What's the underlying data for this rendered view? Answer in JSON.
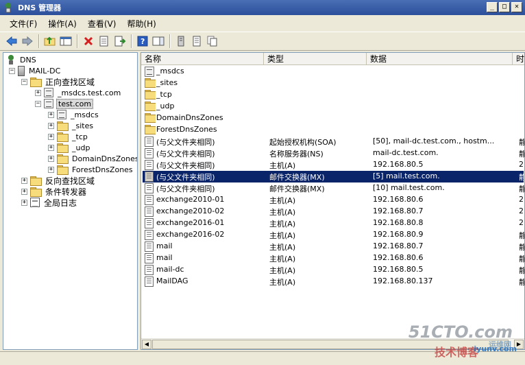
{
  "window": {
    "title": "DNS 管理器",
    "minimize": "_",
    "maximize": "□",
    "close": "✕"
  },
  "menu": [
    "文件(F)",
    "操作(A)",
    "查看(V)",
    "帮助(H)"
  ],
  "tree": [
    {
      "label": "DNS",
      "level": 0,
      "icon": "dns-icon",
      "expander": ""
    },
    {
      "label": "MAIL-DC",
      "level": 1,
      "icon": "server-icon",
      "expander": "−"
    },
    {
      "label": "正向查找区域",
      "level": 2,
      "icon": "folder-icon",
      "expander": "−"
    },
    {
      "label": "_msdcs.test.com",
      "level": 3,
      "icon": "zone-icon",
      "expander": "+"
    },
    {
      "label": "test.com",
      "level": 3,
      "icon": "zone-icon",
      "expander": "−",
      "selected": true
    },
    {
      "label": "_msdcs",
      "level": 4,
      "icon": "zone-icon",
      "expander": "+"
    },
    {
      "label": "_sites",
      "level": 4,
      "icon": "folder-icon",
      "expander": "+"
    },
    {
      "label": "_tcp",
      "level": 4,
      "icon": "folder-icon",
      "expander": "+"
    },
    {
      "label": "_udp",
      "level": 4,
      "icon": "folder-icon",
      "expander": "+"
    },
    {
      "label": "DomainDnsZones",
      "level": 4,
      "icon": "folder-icon",
      "expander": "+"
    },
    {
      "label": "ForestDnsZones",
      "level": 4,
      "icon": "folder-icon",
      "expander": "+"
    },
    {
      "label": "反向查找区域",
      "level": 2,
      "icon": "folder-icon",
      "expander": "+"
    },
    {
      "label": "条件转发器",
      "level": 2,
      "icon": "folder-icon",
      "expander": "+"
    },
    {
      "label": "全局日志",
      "level": 2,
      "icon": "log-icon",
      "expander": "+"
    }
  ],
  "columns": [
    "名称",
    "类型",
    "数据",
    "时"
  ],
  "records": [
    {
      "name": "_msdcs",
      "type": "",
      "data": "",
      "extra": "",
      "icon": "zone-icon"
    },
    {
      "name": "_sites",
      "type": "",
      "data": "",
      "extra": "",
      "icon": "folder-icon"
    },
    {
      "name": "_tcp",
      "type": "",
      "data": "",
      "extra": "",
      "icon": "folder-icon"
    },
    {
      "name": "_udp",
      "type": "",
      "data": "",
      "extra": "",
      "icon": "folder-icon"
    },
    {
      "name": "DomainDnsZones",
      "type": "",
      "data": "",
      "extra": "",
      "icon": "folder-icon"
    },
    {
      "name": "ForestDnsZones",
      "type": "",
      "data": "",
      "extra": "",
      "icon": "folder-icon"
    },
    {
      "name": "(与父文件夹相同)",
      "type": "起始授权机构(SOA)",
      "data": "[50], mail-dc.test.com., hostm...",
      "extra": "静",
      "icon": "record-icon"
    },
    {
      "name": "(与父文件夹相同)",
      "type": "名称服务器(NS)",
      "data": "mail-dc.test.com.",
      "extra": "静",
      "icon": "record-icon"
    },
    {
      "name": "(与父文件夹相同)",
      "type": "主机(A)",
      "data": "192.168.80.5",
      "extra": "2",
      "icon": "record-icon"
    },
    {
      "name": "(与父文件夹相同)",
      "type": "邮件交换器(MX)",
      "data": "[5]  mail.test.com.",
      "extra": "静",
      "icon": "record-icon",
      "selected": true
    },
    {
      "name": "(与父文件夹相同)",
      "type": "邮件交换器(MX)",
      "data": "[10]  mail.test.com.",
      "extra": "静",
      "icon": "record-icon"
    },
    {
      "name": "exchange2010-01",
      "type": "主机(A)",
      "data": "192.168.80.6",
      "extra": "2",
      "icon": "record-icon"
    },
    {
      "name": "exchange2010-02",
      "type": "主机(A)",
      "data": "192.168.80.7",
      "extra": "2",
      "icon": "record-icon"
    },
    {
      "name": "exchange2016-01",
      "type": "主机(A)",
      "data": "192.168.80.8",
      "extra": "2",
      "icon": "record-icon"
    },
    {
      "name": "exchange2016-02",
      "type": "主机(A)",
      "data": "192.168.80.9",
      "extra": "静",
      "icon": "record-icon"
    },
    {
      "name": "mail",
      "type": "主机(A)",
      "data": "192.168.80.7",
      "extra": "静",
      "icon": "record-icon"
    },
    {
      "name": "mail",
      "type": "主机(A)",
      "data": "192.168.80.6",
      "extra": "静",
      "icon": "record-icon"
    },
    {
      "name": "mail-dc",
      "type": "主机(A)",
      "data": "192.168.80.5",
      "extra": "静",
      "icon": "record-icon"
    },
    {
      "name": "MailDAG",
      "type": "主机(A)",
      "data": "192.168.80.137",
      "extra": "静",
      "icon": "record-icon"
    }
  ],
  "watermark": {
    "main": "51CTO.com",
    "sub": "技术博客",
    "tag": "运维网",
    "site": "iyunv.com"
  }
}
